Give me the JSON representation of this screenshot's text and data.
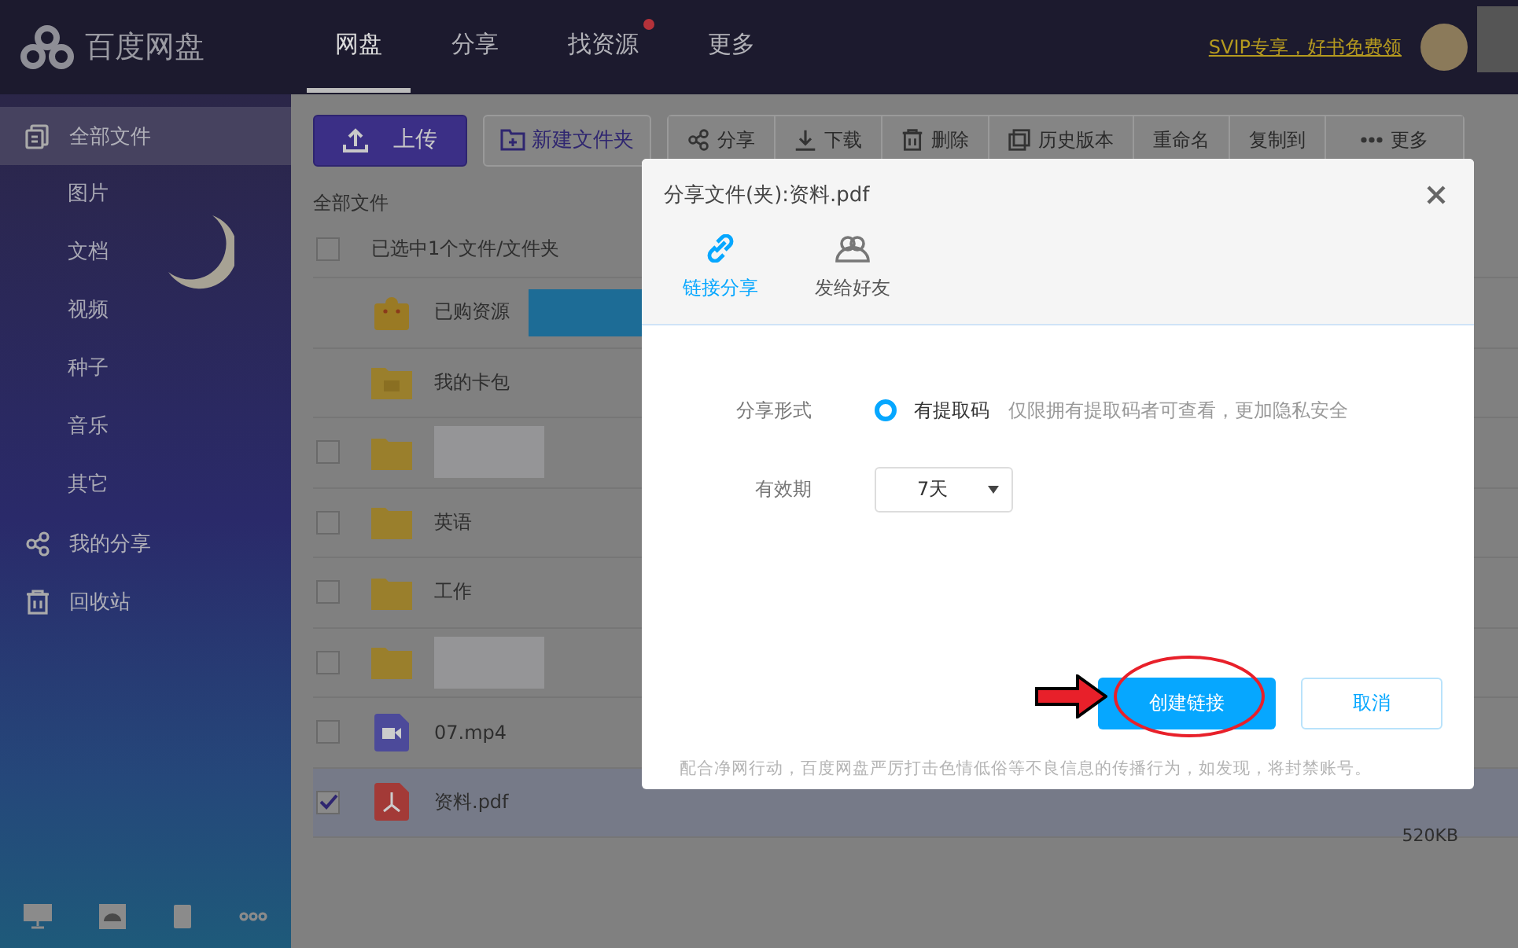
{
  "app": {
    "logo_text": "百度网盘"
  },
  "nav_tabs": [
    {
      "label": "网盘",
      "selected": true,
      "badge": false
    },
    {
      "label": "分享",
      "selected": false,
      "badge": false
    },
    {
      "label": "找资源",
      "selected": false,
      "badge": true
    },
    {
      "label": "更多",
      "selected": false,
      "badge": false
    }
  ],
  "promo_link": "SVIP专享，好书免费领",
  "sidebar": {
    "items": [
      {
        "label": "全部文件",
        "selected": true,
        "children": [
          {
            "label": "图片",
            "selected": false
          },
          {
            "label": "文档",
            "selected": false
          },
          {
            "label": "视频",
            "selected": false
          },
          {
            "label": "种子",
            "selected": false
          },
          {
            "label": "音乐",
            "selected": false
          },
          {
            "label": "其它",
            "selected": false
          }
        ]
      },
      {
        "label": "我的分享",
        "selected": false
      },
      {
        "label": "回收站",
        "selected": false
      }
    ]
  },
  "toolbar": {
    "upload": "上传",
    "new_folder": "新建文件夹",
    "actions": [
      "分享",
      "下载",
      "删除",
      "历史版本",
      "重命名",
      "复制到",
      "更多"
    ]
  },
  "breadcrumb": "全部文件",
  "selection_header": {
    "label": "已选中1个文件/文件夹",
    "checked": false
  },
  "files": [
    {
      "kind": "purchased",
      "name": "已购资源",
      "checkable": false,
      "tooltip": true
    },
    {
      "kind": "cardpack",
      "name": "我的卡包",
      "checkable": false,
      "tooltip": false
    },
    {
      "kind": "folder",
      "redacted": true,
      "checkable": true,
      "checked": false,
      "tooltip": false
    },
    {
      "kind": "folder",
      "name": "英语",
      "checkable": true,
      "checked": false,
      "tooltip": false
    },
    {
      "kind": "folder",
      "name": "工作",
      "checkable": true,
      "checked": false,
      "tooltip": false
    },
    {
      "kind": "folder",
      "redacted": true,
      "checkable": true,
      "checked": false,
      "tooltip": false
    },
    {
      "kind": "video",
      "name": "07.mp4",
      "checkable": true,
      "checked": false,
      "tooltip": false
    },
    {
      "kind": "pdf",
      "name": "资料.pdf",
      "checkable": true,
      "checked": true,
      "tooltip": false,
      "size": "520KB"
    }
  ],
  "dialog": {
    "title": "分享文件(夹):资料.pdf",
    "tabs": [
      {
        "label": "链接分享",
        "selected": true
      },
      {
        "label": "发给好友",
        "selected": false
      }
    ],
    "share_form": {
      "label": "分享形式",
      "option": "有提取码",
      "selected": true,
      "hint": "仅限拥有提取码者可查看，更加隐私安全"
    },
    "validity": {
      "label": "有效期",
      "value": "7天"
    },
    "primary_button": "创建链接",
    "cancel_button": "取消",
    "note": "配合净网行动，百度网盘严厉打击色情低俗等不良信息的传播行为，如发现，将封禁账号。"
  },
  "annotations": [
    {
      "kind": "arrow"
    },
    {
      "kind": "ellipse"
    }
  ]
}
